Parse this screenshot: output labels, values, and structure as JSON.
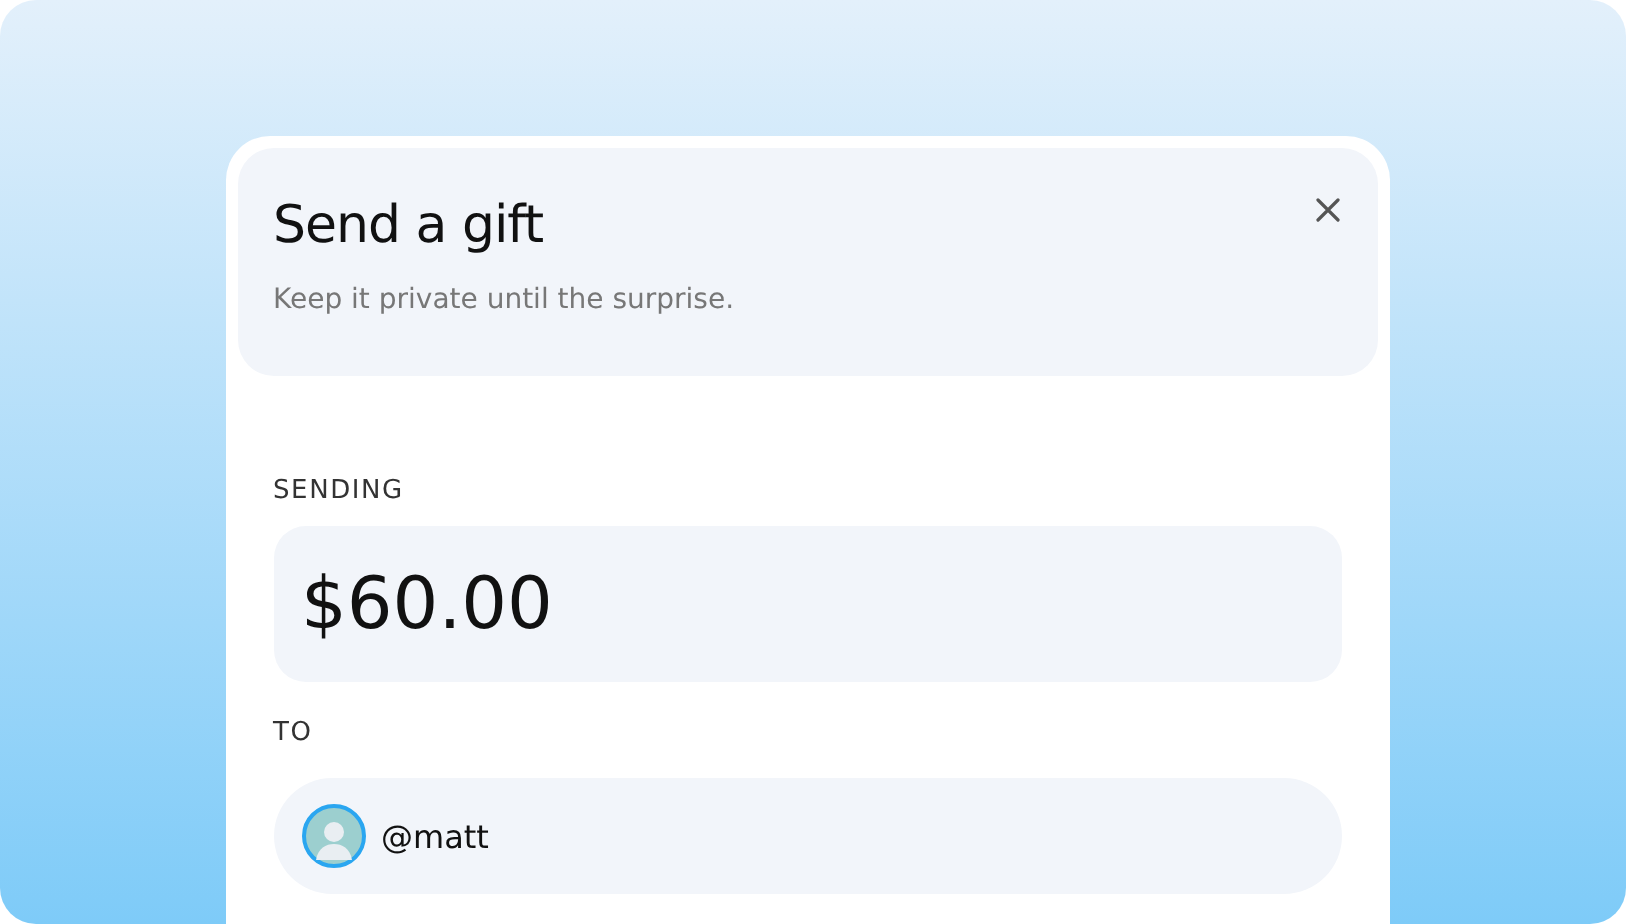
{
  "dialog": {
    "title": "Send a gift",
    "subtitle": "Keep it private until the surprise."
  },
  "amount": {
    "label": "SENDING",
    "value": "$60.00"
  },
  "recipient": {
    "label": "TO",
    "value": "@matt"
  }
}
